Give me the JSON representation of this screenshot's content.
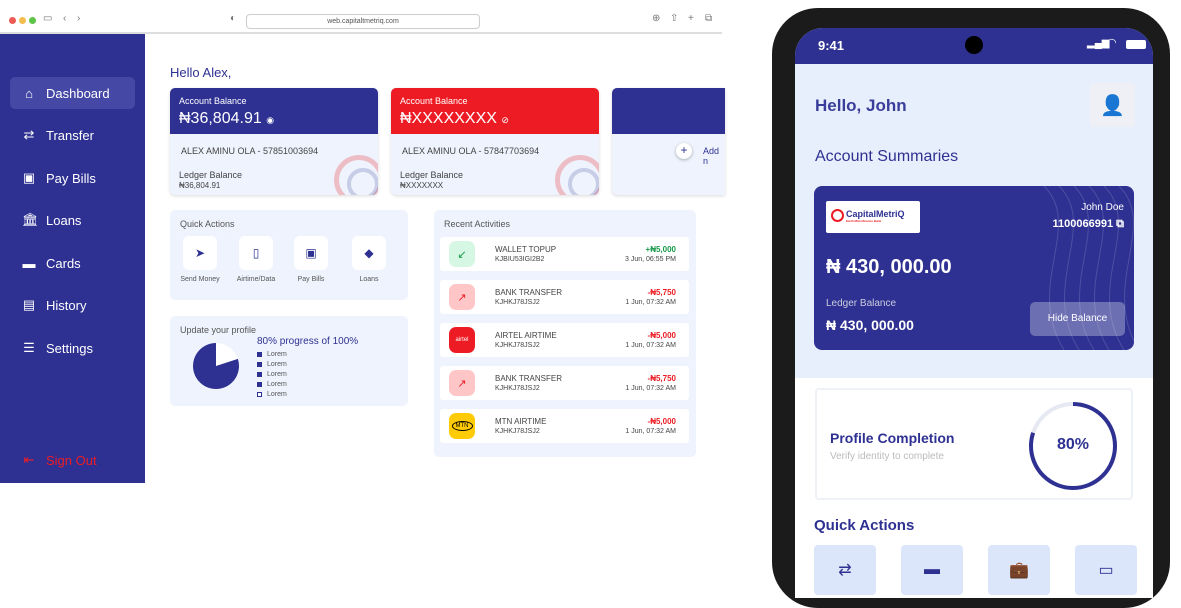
{
  "browser": {
    "url": "web.capitaltmetriq.com"
  },
  "sidebar": {
    "items": [
      {
        "label": "Dashboard",
        "icon": "home-icon"
      },
      {
        "label": "Transfer",
        "icon": "transfer-icon"
      },
      {
        "label": "Pay Bills",
        "icon": "bills-icon"
      },
      {
        "label": "Loans",
        "icon": "bank-icon"
      },
      {
        "label": "Cards",
        "icon": "card-icon"
      },
      {
        "label": "History",
        "icon": "history-icon"
      },
      {
        "label": "Settings",
        "icon": "settings-icon"
      }
    ],
    "signout": "Sign Out"
  },
  "main": {
    "greeting": "Hello Alex,",
    "cards": [
      {
        "label": "Account Balance",
        "balance": "₦36,804.91",
        "account": "ALEX AMINU OLA  -  57851003694",
        "ledger_label": "Ledger Balance",
        "ledger": "₦36,804.91",
        "color": "#2e3192"
      },
      {
        "label": "Account Balance",
        "balance": "₦XXXXXXXX",
        "account": "ALEX AMINU OLA  -  57847703694",
        "ledger_label": "Ledger Balance",
        "ledger": "₦XXXXXXX",
        "color": "#ed1c24"
      }
    ],
    "add_account": "Add n",
    "quick_actions": {
      "title": "Quick Actions",
      "items": [
        "Send Money",
        "Airtime/Data",
        "Pay Bills",
        "Loans"
      ]
    },
    "profile": {
      "title": "Update your profile",
      "progress_text": "80% progress of 100%",
      "progress": 80,
      "remaining_label": "20%",
      "legend": [
        "Lorem",
        "Lorem",
        "Lorem",
        "Lorem",
        "Lorem"
      ]
    },
    "recent": {
      "title": "Recent Activities",
      "items": [
        {
          "title": "WALLET TOPUP",
          "ref": "KJBIU53IGI2B2",
          "amount": "+₦5,000",
          "date": "3 Jun, 06:55 PM",
          "type": "credit"
        },
        {
          "title": "BANK TRANSFER",
          "ref": "KJHKJ78JSJ2",
          "amount": "-₦5,750",
          "date": "1 Jun, 07:32 AM",
          "type": "debit"
        },
        {
          "title": "AIRTEL AIRTIME",
          "ref": "KJHKJ78JSJ2",
          "amount": "-₦5,000",
          "date": "1 Jun, 07:32 AM",
          "type": "airtel",
          "logo": "airtel"
        },
        {
          "title": "BANK TRANSFER",
          "ref": "KJHKJ78JSJ2",
          "amount": "-₦5,750",
          "date": "1 Jun, 07:32 AM",
          "type": "debit"
        },
        {
          "title": "MTN AIRTIME",
          "ref": "KJHKJ78JSJ2",
          "amount": "-₦5,000",
          "date": "1 Jun, 07:32 AM",
          "type": "mtn",
          "logo": "MTN"
        }
      ]
    }
  },
  "phone": {
    "time": "9:41",
    "greeting": "Hello, John",
    "section": "Account Summaries",
    "card": {
      "brand": "CapitalMetriQ",
      "brand_sub": "Earth Microfinance Bank",
      "name": "John Doe",
      "account": "1100066991",
      "balance": "₦ 430, 000.00",
      "ledger_label": "Ledger Balance",
      "ledger": "₦ 430, 000.00",
      "hide_button": "Hide Balance"
    },
    "profile": {
      "title": "Profile Completion",
      "subtitle": "Verify identity to complete",
      "percent": "80%",
      "progress": 80
    },
    "quick_actions": "Quick Actions"
  },
  "colors": {
    "primary": "#2e3192",
    "accent": "#ed1c24",
    "credit": "#1a9a4a",
    "debit": "#ed1c24"
  }
}
